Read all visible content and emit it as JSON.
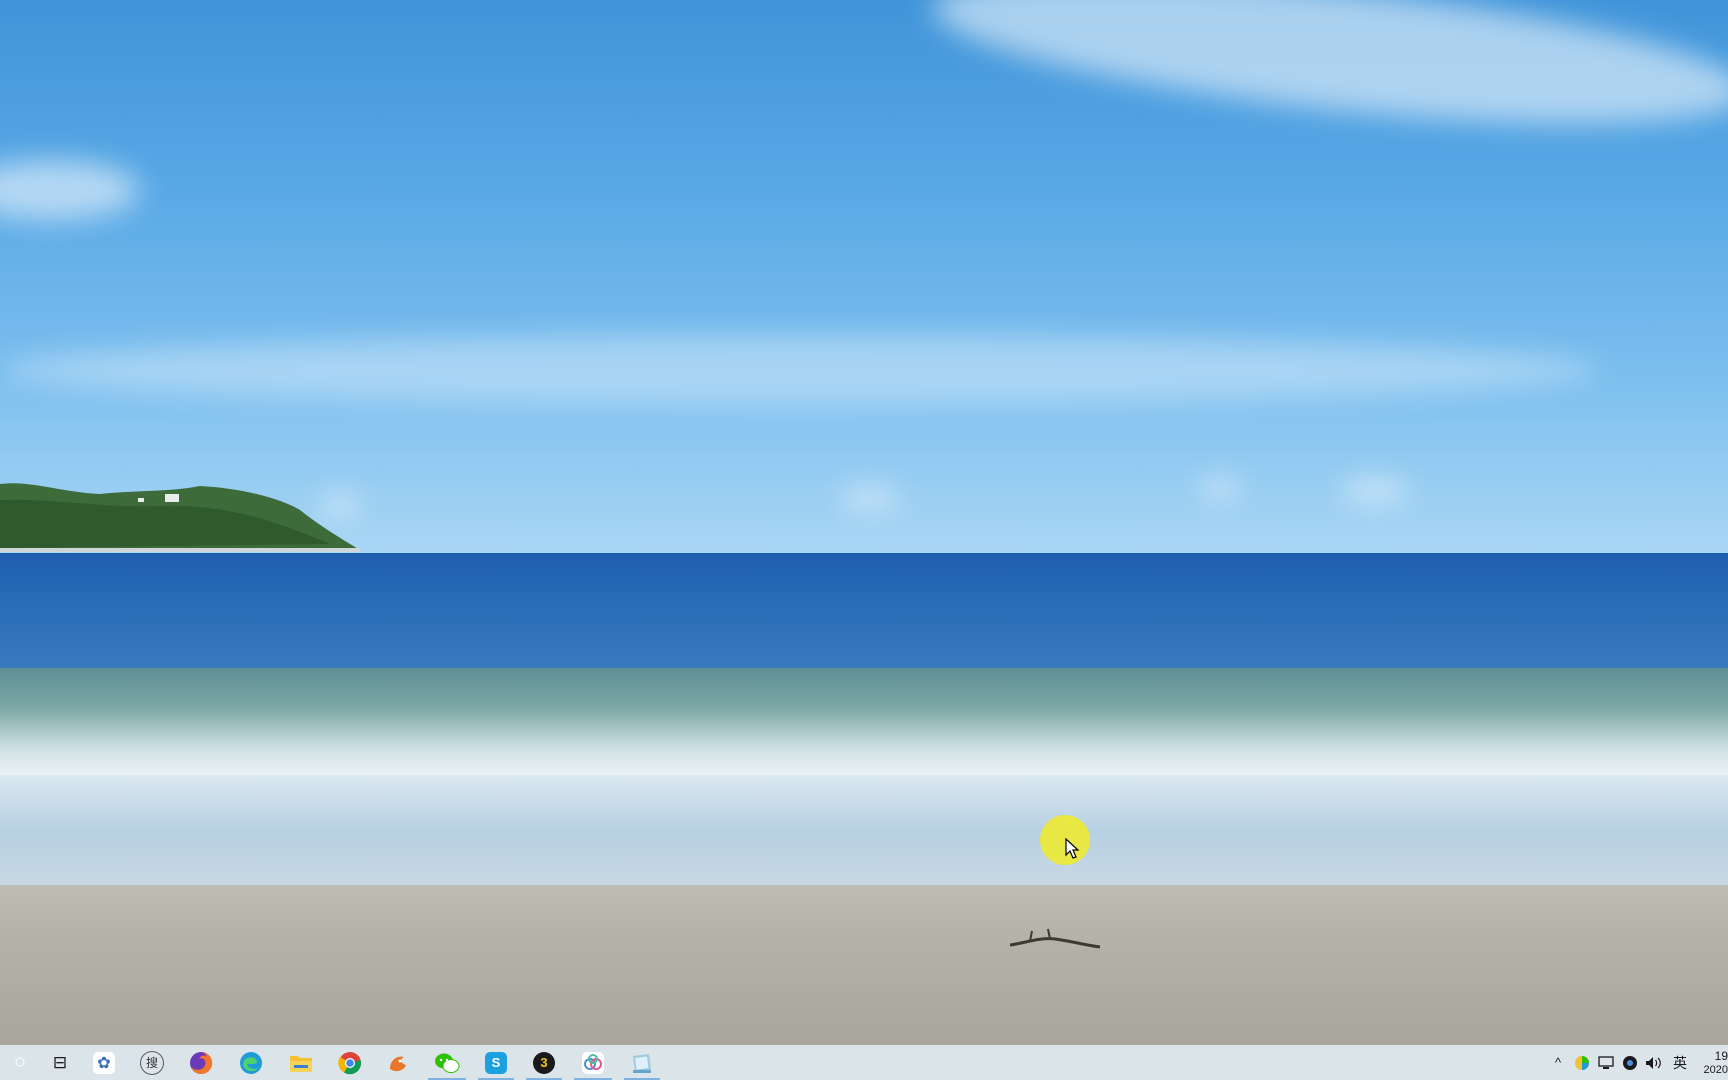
{
  "taskbar": {
    "start_glyph": "○",
    "task_view_glyph": "⊟",
    "pinned": [
      {
        "name": "pinwheel-app-icon",
        "glyph": "✿",
        "color": "#3b6fb6",
        "running": false
      },
      {
        "name": "sogou-search-icon",
        "glyph": "搜",
        "color": "#5a5a5a",
        "running": false
      },
      {
        "name": "firefox-icon",
        "glyph": "",
        "color": "#e8702a",
        "running": false
      },
      {
        "name": "edge-icon",
        "glyph": "",
        "color": "#1f9bd8",
        "running": false
      },
      {
        "name": "file-explorer-icon",
        "glyph": "",
        "color": "#f2c233",
        "running": false
      },
      {
        "name": "chrome-icon",
        "glyph": "",
        "color": "#db4437",
        "running": false
      },
      {
        "name": "orange-bird-app-icon",
        "glyph": "",
        "color": "#e9762b",
        "running": false
      },
      {
        "name": "wechat-icon",
        "glyph": "",
        "color": "#2dc100",
        "running": true
      },
      {
        "name": "s-app-icon",
        "glyph": "S",
        "color": "#1da0e0",
        "running": true
      },
      {
        "name": "3-app-icon",
        "glyph": "3",
        "color": "#f5c518",
        "running": true
      },
      {
        "name": "cloud-drive-icon",
        "glyph": "",
        "color": "#4a90e2",
        "running": true
      },
      {
        "name": "notebook-app-icon",
        "glyph": "",
        "color": "#6aa5c9",
        "running": true
      }
    ],
    "tray": {
      "overflow_chevron": "^",
      "ime_label": "英",
      "clock_time": "19",
      "clock_date": "2020"
    }
  },
  "colors": {
    "taskbar_bg": "#becdd7",
    "cursor_highlight": "#f0eb28"
  }
}
